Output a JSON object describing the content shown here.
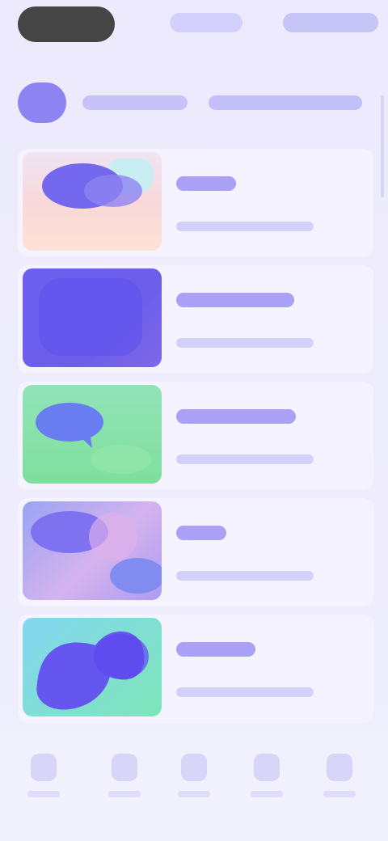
{
  "topbar": {
    "left_label": "",
    "center_label": "",
    "right_label": ""
  },
  "header": {
    "title": "",
    "subtitle": ""
  },
  "items": [
    {
      "title": "",
      "meta": "",
      "thumbnail_icon": "cloud-card-image-icon"
    },
    {
      "title": "",
      "meta": "",
      "thumbnail_icon": "violet-tile-image-icon"
    },
    {
      "title": "",
      "meta": "",
      "thumbnail_icon": "green-chat-image-icon"
    },
    {
      "title": "",
      "meta": "",
      "thumbnail_icon": "pastel-abstract-image-icon"
    },
    {
      "title": "",
      "meta": "",
      "thumbnail_icon": "blob-image-icon"
    }
  ],
  "bottom_nav": [
    {
      "label": "",
      "icon": "home-icon"
    },
    {
      "label": "",
      "icon": "search-icon"
    },
    {
      "label": "",
      "icon": "add-icon"
    },
    {
      "label": "",
      "icon": "library-icon"
    },
    {
      "label": "",
      "icon": "profile-icon"
    }
  ],
  "colors": {
    "background": "#ecebfc",
    "accent": "#6f67e8",
    "surface": "#f4f3ff"
  }
}
